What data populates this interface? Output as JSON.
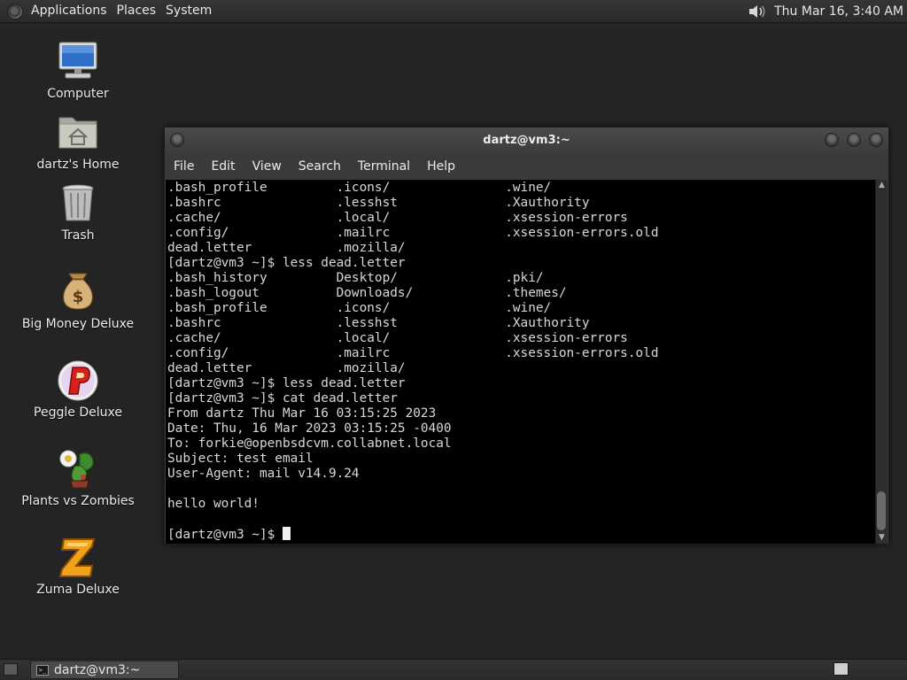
{
  "top_panel": {
    "menus": [
      "Applications",
      "Places",
      "System"
    ],
    "clock": "Thu Mar 16,  3:40 AM"
  },
  "desktop_icons": [
    {
      "label": "Computer",
      "icon": "computer-icon"
    },
    {
      "label": "dartz's Home",
      "icon": "home-folder-icon"
    },
    {
      "label": "Trash",
      "icon": "trash-icon"
    },
    {
      "label": "Big Money Deluxe",
      "icon": "money-bag-icon"
    },
    {
      "label": "Peggle Deluxe",
      "icon": "peggle-icon"
    },
    {
      "label": "Plants vs Zombies",
      "icon": "plants-vs-zombies-icon"
    },
    {
      "label": "Zuma Deluxe",
      "icon": "zuma-icon"
    }
  ],
  "terminal": {
    "title": "dartz@vm3:~",
    "menu": [
      "File",
      "Edit",
      "View",
      "Search",
      "Terminal",
      "Help"
    ],
    "lines": [
      ".bash_profile         .icons/               .wine/",
      ".bashrc               .lesshst              .Xauthority",
      ".cache/               .local/               .xsession-errors",
      ".config/              .mailrc               .xsession-errors.old",
      "dead.letter           .mozilla/",
      "[dartz@vm3 ~]$ less dead.letter",
      ".bash_history         Desktop/              .pki/",
      ".bash_logout          Downloads/            .themes/",
      ".bash_profile         .icons/               .wine/",
      ".bashrc               .lesshst              .Xauthority",
      ".cache/               .local/               .xsession-errors",
      ".config/              .mailrc               .xsession-errors.old",
      "dead.letter           .mozilla/",
      "[dartz@vm3 ~]$ less dead.letter",
      "[dartz@vm3 ~]$ cat dead.letter",
      "From dartz Thu Mar 16 03:15:25 2023",
      "Date: Thu, 16 Mar 2023 03:15:25 -0400",
      "To: forkie@openbsdcvm.collabnet.local",
      "Subject: test email",
      "User-Agent: mail v14.9.24",
      "",
      "hello world!",
      ""
    ],
    "prompt": "[dartz@vm3 ~]$ "
  },
  "taskbar": {
    "task_label": "dartz@vm3:~"
  },
  "colors": {
    "desktop_bg": "#242424",
    "terminal_bg": "#000000",
    "terminal_fg": "#d8d8d8"
  }
}
